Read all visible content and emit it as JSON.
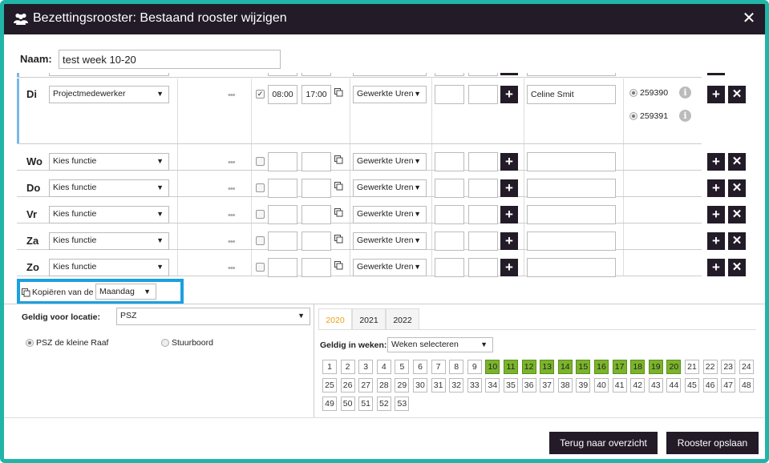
{
  "window": {
    "title": "Bezettingsrooster: Bestaand rooster wijzigen",
    "close_glyph": "✕"
  },
  "name": {
    "label": "Naam:",
    "value": "test week 10-20"
  },
  "rows": [
    {
      "day": "Di",
      "function": "Projectmedewerker",
      "checked": true,
      "start": "08:00",
      "end": "17:00",
      "hours_type": "Gewerkte Uren",
      "person": "Celine Smit",
      "ids": [
        "259390",
        "259391"
      ]
    },
    {
      "day": "Wo",
      "function": "Kies functie",
      "checked": false,
      "start": "",
      "end": "",
      "hours_type": "Gewerkte Uren",
      "person": ""
    },
    {
      "day": "Do",
      "function": "Kies functie",
      "checked": false,
      "start": "",
      "end": "",
      "hours_type": "Gewerkte Uren",
      "person": ""
    },
    {
      "day": "Vr",
      "function": "Kies functie",
      "checked": false,
      "start": "",
      "end": "",
      "hours_type": "Gewerkte Uren",
      "person": ""
    },
    {
      "day": "Za",
      "function": "Kies functie",
      "checked": false,
      "start": "",
      "end": "",
      "hours_type": "Gewerkte Uren",
      "person": ""
    },
    {
      "day": "Zo",
      "function": "Kies functie",
      "checked": false,
      "start": "",
      "end": "",
      "hours_type": "Gewerkte Uren",
      "person": ""
    }
  ],
  "row_glyphs": {
    "dots": "•••",
    "plus": "+",
    "times": "✕",
    "caret": "▼",
    "info": "i",
    "check": "✓"
  },
  "copy_from": {
    "label": "Kopiëren van de",
    "value": "Maandag"
  },
  "location": {
    "label": "Geldig voor locatie:",
    "value": "PSZ",
    "options": [
      {
        "label": "PSZ de kleine Raaf",
        "selected": true
      },
      {
        "label": "Stuurboord",
        "selected": false
      }
    ]
  },
  "years": {
    "tabs": [
      "2020",
      "2021",
      "2022"
    ],
    "active": "2020"
  },
  "weeks": {
    "label": "Geldig in weken:",
    "select_value": "Weken selecteren",
    "numbers": [
      "1",
      "2",
      "3",
      "4",
      "5",
      "6",
      "7",
      "8",
      "9",
      "10",
      "11",
      "12",
      "13",
      "14",
      "15",
      "16",
      "17",
      "18",
      "19",
      "20",
      "21",
      "22",
      "23",
      "24",
      "25",
      "26",
      "27",
      "28",
      "29",
      "30",
      "31",
      "32",
      "33",
      "34",
      "35",
      "36",
      "37",
      "38",
      "39",
      "40",
      "41",
      "42",
      "43",
      "44",
      "45",
      "46",
      "47",
      "48",
      "49",
      "50",
      "51",
      "52",
      "53"
    ],
    "selected": [
      "10",
      "11",
      "12",
      "13",
      "14",
      "15",
      "16",
      "17",
      "18",
      "19",
      "20"
    ]
  },
  "buttons": {
    "back": "Terug naar overzicht",
    "save": "Rooster opslaan"
  },
  "colors": {
    "dark": "#231b28",
    "accent_border": "#21b5a8",
    "highlight": "#1ca0e0",
    "week_selected": "#7bb42c",
    "tab_active": "#e8a317"
  },
  "icons": [
    "users-icon",
    "close-icon",
    "copy-icon",
    "plus-icon",
    "delete-icon",
    "info-icon",
    "chevron-down-icon",
    "more-icon"
  ]
}
